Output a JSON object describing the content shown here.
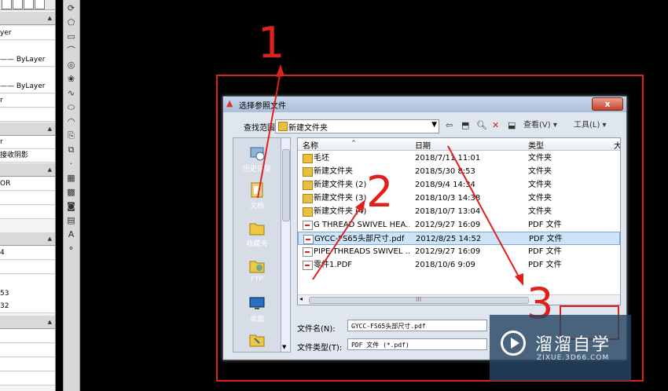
{
  "props": {
    "rows": [
      "yer",
      "—— ByLayer",
      "—— ByLayer",
      "r",
      "r",
      "接收阴影",
      "OR",
      "4",
      "53",
      "32"
    ]
  },
  "dialog": {
    "title": "选择参照文件",
    "close_label": "x",
    "lookin_label": "查找范围(I):",
    "lookin_value": "新建文件夹",
    "view_label": "查看(V) ▾",
    "tools_label": "工具(L) ▾",
    "places": [
      "历史记录",
      "文档",
      "收藏夹",
      "FTP",
      "桌面"
    ],
    "columns": [
      "名称",
      "日期",
      "类型",
      "大"
    ],
    "files": [
      {
        "name": "毛坯",
        "date": "2018/7/11 11:01",
        "type": "文件夹",
        "icon": "folder"
      },
      {
        "name": "新建文件夹",
        "date": "2018/5/30 8:53",
        "type": "文件夹",
        "icon": "folder"
      },
      {
        "name": "新建文件夹 (2)",
        "date": "2018/9/4 14:34",
        "type": "文件夹",
        "icon": "folder"
      },
      {
        "name": "新建文件夹 (3)",
        "date": "2018/10/3 14:38",
        "type": "文件夹",
        "icon": "folder"
      },
      {
        "name": "新建文件夹 (4)",
        "date": "2018/10/7 13:04",
        "type": "文件夹",
        "icon": "folder"
      },
      {
        "name": "G THREAD SWIVEL HEA...",
        "date": "2012/9/27 16:09",
        "type": "PDF 文件",
        "icon": "pdf"
      },
      {
        "name": "GYCC-FS65头部尺寸.pdf",
        "date": "2012/8/25 14:52",
        "type": "PDF 文件",
        "icon": "pdf",
        "selected": true
      },
      {
        "name": "PIPE THREADS SWIVEL ...",
        "date": "2012/9/27 16:09",
        "type": "PDF 文件",
        "icon": "pdf"
      },
      {
        "name": "零件1.PDF",
        "date": "2018/10/6 9:09",
        "type": "PDF 文件",
        "icon": "pdf"
      }
    ],
    "filename_label": "文件名(N):",
    "filename_value": "GYCC-FS65头部尺寸.pdf",
    "filetype_label": "文件类型(T):",
    "filetype_value": "PDF 文件 (*.pdf)",
    "scroll_grip": "III"
  },
  "annotations": {
    "n1": "1",
    "n2": "2",
    "n3": "3",
    "color": "#e0201a"
  },
  "watermark": {
    "name": "溜溜自学",
    "url": "ZIXUE.3D66.COM"
  }
}
